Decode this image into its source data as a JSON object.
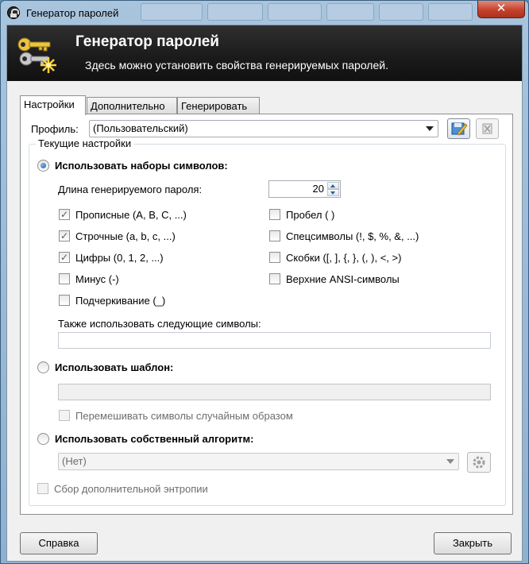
{
  "window": {
    "title": "Генератор паролей",
    "close_glyph": "✕"
  },
  "banner": {
    "title": "Генератор паролей",
    "subtitle": "Здесь можно установить свойства генерируемых паролей."
  },
  "tabs": [
    {
      "label": "Настройки",
      "active": true
    },
    {
      "label": "Дополнительно",
      "active": false
    },
    {
      "label": "Генерировать",
      "active": false
    }
  ],
  "profile": {
    "label": "Профиль:",
    "value": "(Пользовательский)"
  },
  "current": {
    "legend": "Текущие настройки",
    "charsets": {
      "label": "Использовать наборы символов:",
      "selected": true,
      "length_label": "Длина генерируемого пароля:",
      "length_value": "20",
      "left": [
        {
          "label": "Прописные (A, B, C, ...)",
          "checked": true
        },
        {
          "label": "Строчные (a, b, c, ...)",
          "checked": true
        },
        {
          "label": "Цифры (0, 1, 2, ...)",
          "checked": true
        },
        {
          "label": "Минус (-)",
          "checked": false
        },
        {
          "label": "Подчеркивание (_)",
          "checked": false
        }
      ],
      "right": [
        {
          "label": "Пробел ( )",
          "checked": false
        },
        {
          "label": "Спецсимволы (!, $, %, &, ...)",
          "checked": false
        },
        {
          "label": "Скобки ([, ], {, }, (, ), <, >)",
          "checked": false
        },
        {
          "label": "Верхние ANSI-символы",
          "checked": false
        }
      ],
      "also_label": "Также использовать следующие символы:",
      "also_value": ""
    },
    "pattern": {
      "label": "Использовать шаблон:",
      "selected": false,
      "value": "",
      "shuffle_label": "Перемешивать символы случайным образом",
      "shuffle_checked": false
    },
    "custom": {
      "label": "Использовать собственный алгоритм:",
      "selected": false,
      "value": "(Нет)"
    },
    "entropy": {
      "label": "Сбор дополнительной энтропии",
      "checked": false
    }
  },
  "buttons": {
    "help": "Справка",
    "close": "Закрыть"
  },
  "colors": {
    "banner_bg": "#1a1a1a",
    "radio_accent": "#1c5fb2",
    "close_button": "#c6412b"
  }
}
